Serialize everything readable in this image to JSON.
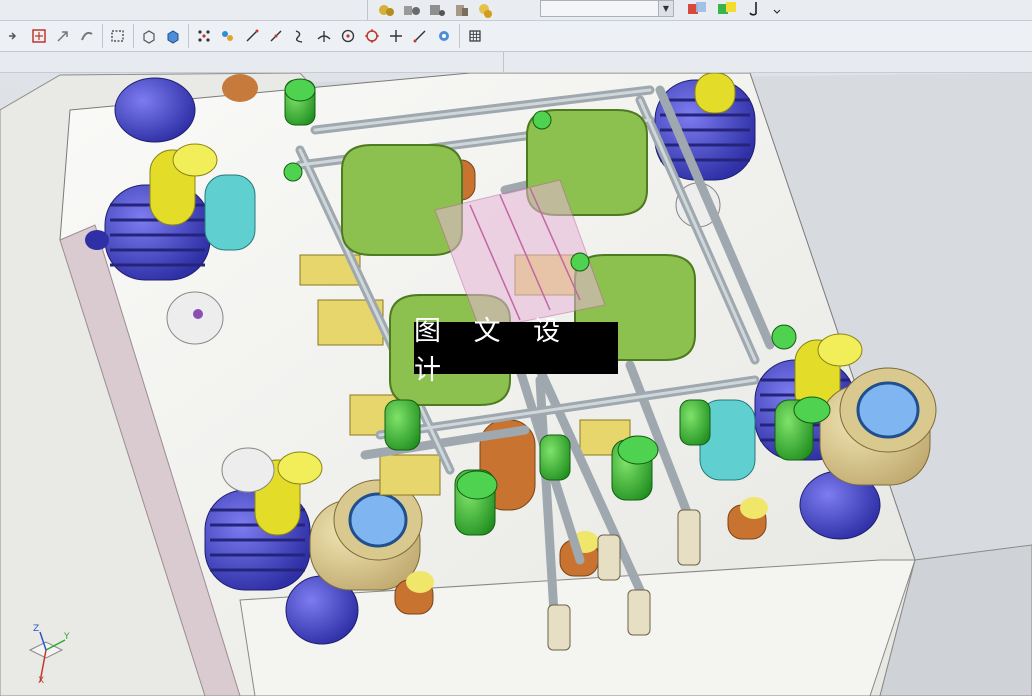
{
  "watermark": {
    "text": "图 文 设 计"
  },
  "toolbar": {
    "icons": [
      "snap-icon",
      "select-filter-icon",
      "move-icon",
      "rotate-icon",
      "box-select-icon",
      "shaded-icon",
      "wireframe-icon",
      "grid-points-icon",
      "pattern-icon",
      "line-icon",
      "line2-icon",
      "curve-icon",
      "normal-icon",
      "circle-point-icon",
      "circle-icon",
      "cross-icon",
      "slash-icon",
      "settings-icon",
      "matrix-icon"
    ]
  },
  "top_toolbar": {
    "icons": [
      "assembly-icon",
      "component-icon",
      "constraint-icon",
      "part-icon",
      "explode-icon",
      "view-cube-icon",
      "color-icon",
      "music-icon"
    ]
  },
  "viewport": {
    "triad": {
      "x": "X",
      "y": "Y",
      "z": "Z"
    }
  },
  "colors": {
    "plate": "#f2f2f0",
    "cavity_green": "#8cc04f",
    "spring_blue": "#4f4fd6",
    "pin_yellow": "#e3dd2a",
    "bolt_green": "#2fbf2f",
    "rod_gray": "#b9c3c8"
  }
}
